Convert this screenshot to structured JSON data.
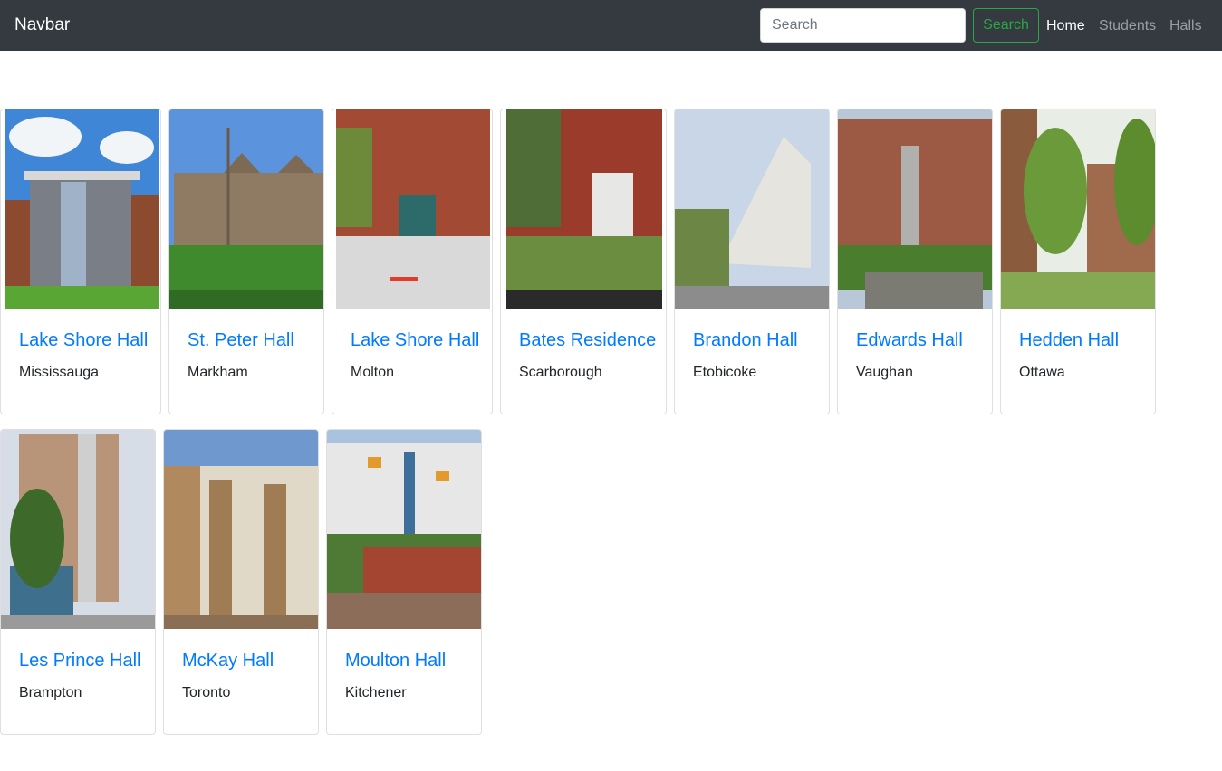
{
  "navbar": {
    "brand": "Navbar",
    "search_placeholder": "Search",
    "search_button": "Search",
    "links": [
      "Home",
      "Students",
      "Halls"
    ]
  },
  "halls": [
    {
      "name": "Lake Shore Hall",
      "city": "Mississauga"
    },
    {
      "name": "St. Peter Hall",
      "city": "Markham"
    },
    {
      "name": "Lake Shore Hall",
      "city": "Molton"
    },
    {
      "name": "Bates Residence",
      "city": "Scarborough"
    },
    {
      "name": "Brandon Hall",
      "city": "Etobicoke"
    },
    {
      "name": "Edwards Hall",
      "city": "Vaughan"
    },
    {
      "name": "Hedden Hall",
      "city": "Ottawa"
    },
    {
      "name": "Les Prince Hall",
      "city": "Brampton"
    },
    {
      "name": "McKay Hall",
      "city": "Toronto"
    },
    {
      "name": "Moulton Hall",
      "city": "Kitchener"
    }
  ],
  "colors": {
    "navbar_bg": "#343a40",
    "link_blue": "#007bff",
    "search_green": "#28a745"
  }
}
